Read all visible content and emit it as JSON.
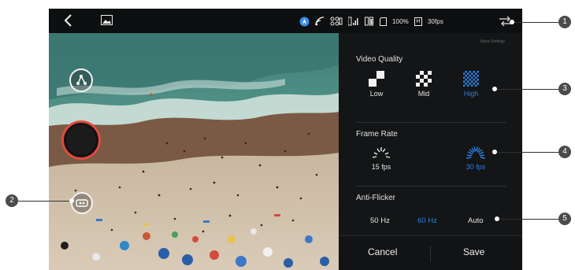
{
  "topbar": {
    "battery_text": "100%",
    "resolution_badge": "H",
    "framerate_text": "30fps",
    "icons": [
      "back-icon",
      "gallery-icon",
      "gps-icon",
      "wifi-signal-icon",
      "controller-icon",
      "signal-bars-icon",
      "battery-icon",
      "sd-card-icon",
      "settings-icon"
    ]
  },
  "panel": {
    "caption": "Video Settings",
    "video_quality": {
      "title": "Video Quality",
      "options": [
        {
          "label": "Low",
          "selected": false
        },
        {
          "label": "Mid",
          "selected": false
        },
        {
          "label": "High",
          "selected": true
        }
      ]
    },
    "frame_rate": {
      "title": "Frame Rate",
      "options": [
        {
          "label": "15 fps",
          "selected": false
        },
        {
          "label": "30 fps",
          "selected": true
        }
      ]
    },
    "anti_flicker": {
      "title": "Anti-Flicker",
      "options": [
        {
          "label": "50 Hz",
          "selected": false
        },
        {
          "label": "60 Hz",
          "selected": true
        },
        {
          "label": "Auto",
          "selected": false
        }
      ]
    },
    "cancel_label": "Cancel",
    "save_label": "Save"
  },
  "callouts": [
    "1",
    "2",
    "3",
    "4",
    "5"
  ],
  "colors": {
    "accent": "#2a7fe0",
    "panel_bg": "#141516",
    "record_ring": "#e04a42"
  }
}
